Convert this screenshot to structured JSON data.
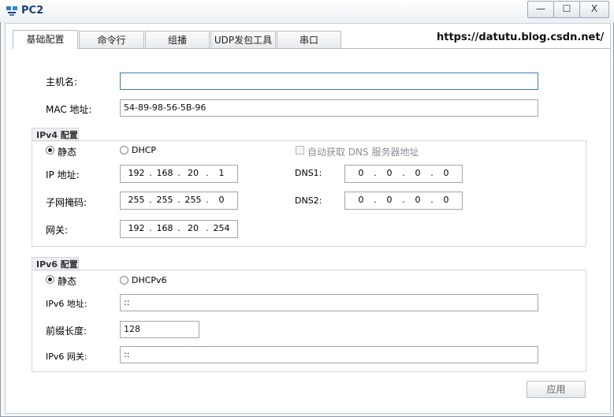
{
  "window": {
    "title": "PC2",
    "min_label": "—",
    "max_label": "☐",
    "close_label": "X"
  },
  "tabs": [
    "基础配置",
    "命令行",
    "组播",
    "UDP发包工具",
    "串口"
  ],
  "watermark_url": "https://datutu.blog.csdn.net/",
  "basic": {
    "hostname_label": "主机名:",
    "hostname_value": "",
    "mac_label": "MAC 地址:",
    "mac_value": "54-89-98-56-5B-96"
  },
  "ipv4": {
    "group_title": "IPv4 配置",
    "static_label": "静态",
    "dhcp_label": "DHCP",
    "auto_dns_label": "自动获取 DNS 服务器地址",
    "ip_label": "IP 地址:",
    "ip": [
      "192",
      "168",
      "20",
      "1"
    ],
    "mask_label": "子网掩码:",
    "mask": [
      "255",
      "255",
      "255",
      "0"
    ],
    "gateway_label": "网关:",
    "gateway": [
      "192",
      "168",
      "20",
      "254"
    ],
    "dns1_label": "DNS1:",
    "dns1": [
      "0",
      "0",
      "0",
      "0"
    ],
    "dns2_label": "DNS2:",
    "dns2": [
      "0",
      "0",
      "0",
      "0"
    ],
    "mode": "static"
  },
  "ipv6": {
    "group_title": "IPv6 配置",
    "static_label": "静态",
    "dhcp_label": "DHCPv6",
    "addr_label": "IPv6 地址:",
    "addr_value": "::",
    "prefix_label": "前缀长度:",
    "prefix_value": "128",
    "gateway_label": "IPv6 网关:",
    "gateway_value": "::",
    "mode": "static"
  },
  "apply_label": "应用"
}
